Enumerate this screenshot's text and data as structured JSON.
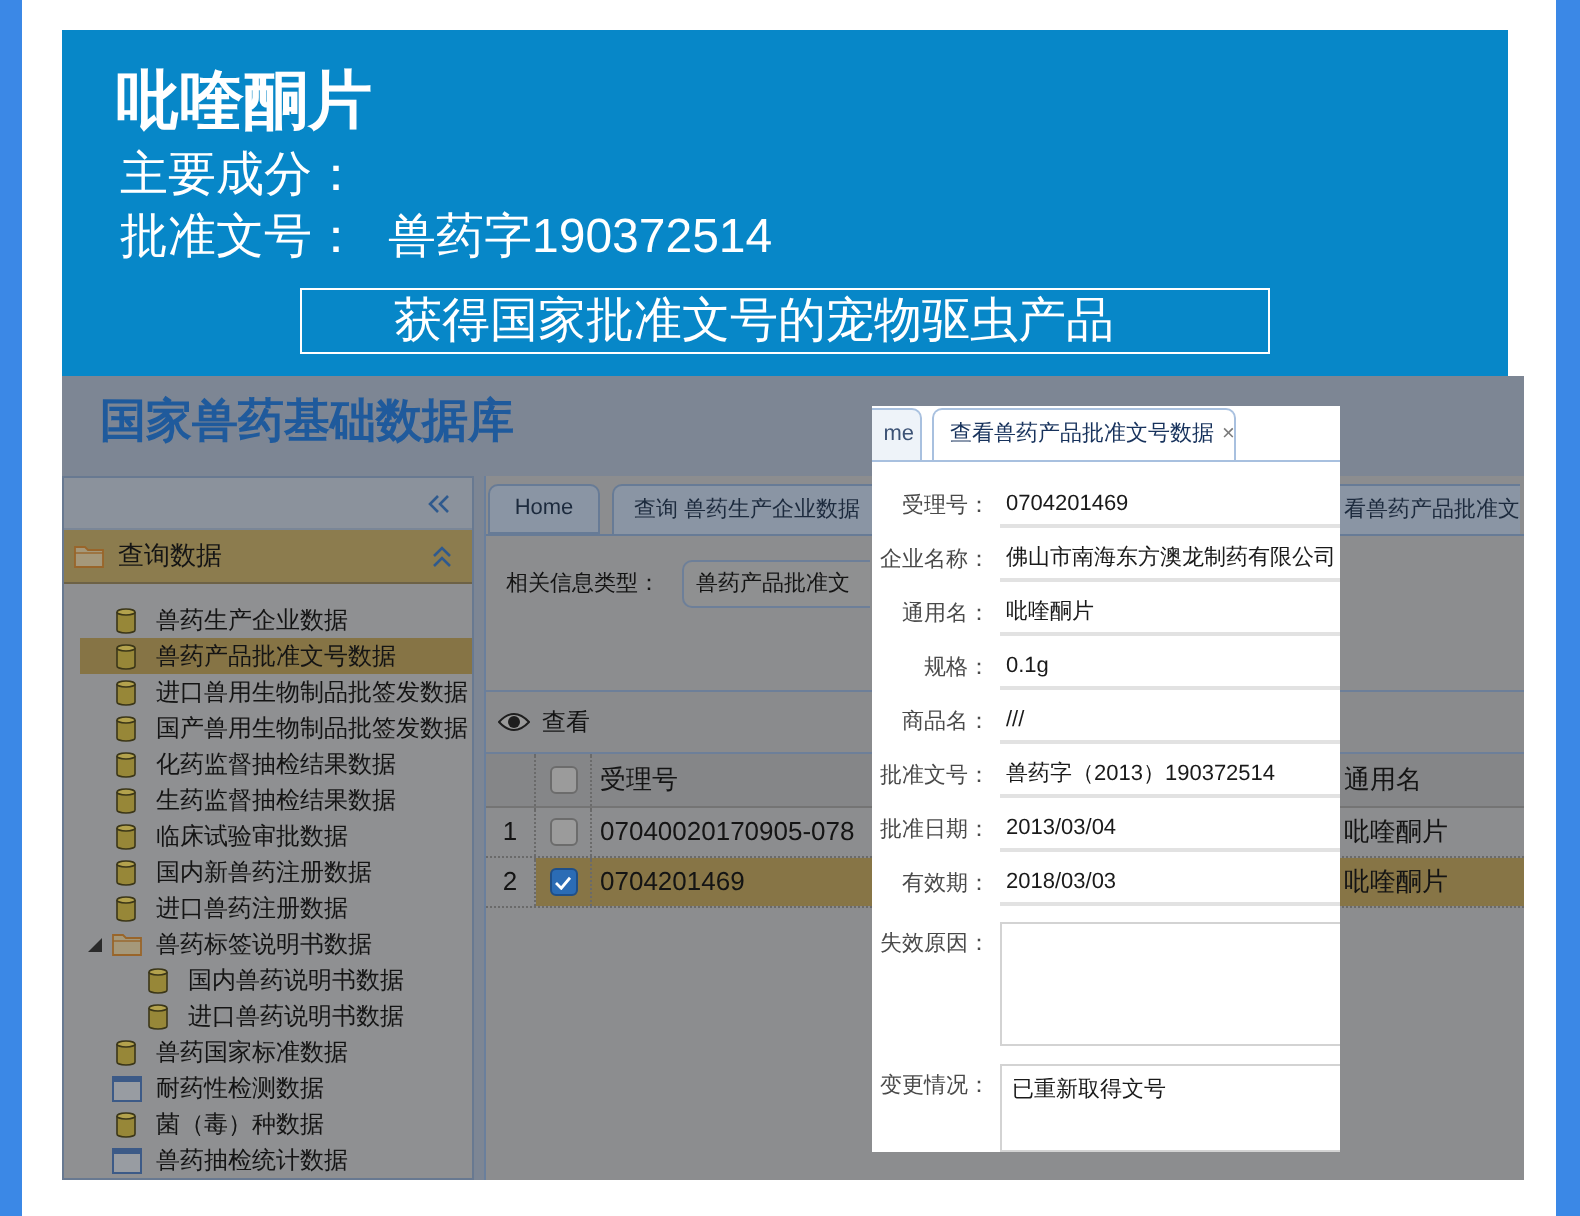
{
  "banner": {
    "title": "吡喹酮片",
    "facts": [
      {
        "label": "主要成分："
      },
      {
        "label": "批准文号：",
        "value": "兽药字190372514"
      }
    ],
    "tagline": "获得国家批准文号的宠物驱虫产品"
  },
  "app": {
    "title": "国家兽药基础数据库",
    "sidebar": {
      "section": {
        "title": "查询数据",
        "expanded": true
      },
      "items": [
        {
          "label": "兽药生产企业数据",
          "kind": "database",
          "selected": false
        },
        {
          "label": "兽药产品批准文号数据",
          "kind": "database",
          "selected": true
        },
        {
          "label": "进口兽用生物制品批签发数据",
          "kind": "database",
          "selected": false
        },
        {
          "label": "国产兽用生物制品批签发数据",
          "kind": "database",
          "selected": false
        },
        {
          "label": "化药监督抽检结果数据",
          "kind": "database",
          "selected": false
        },
        {
          "label": "生药监督抽检结果数据",
          "kind": "database",
          "selected": false
        },
        {
          "label": "临床试验审批数据",
          "kind": "database",
          "selected": false
        },
        {
          "label": "国内新兽药注册数据",
          "kind": "database",
          "selected": false
        },
        {
          "label": "进口兽药注册数据",
          "kind": "database",
          "selected": false
        },
        {
          "label": "兽药标签说明书数据",
          "kind": "folder",
          "selected": false,
          "expanded": true,
          "children": [
            {
              "label": "国内兽药说明书数据",
              "kind": "database",
              "selected": false
            },
            {
              "label": "进口兽药说明书数据",
              "kind": "database",
              "selected": false
            }
          ]
        },
        {
          "label": "兽药国家标准数据",
          "kind": "database",
          "selected": false
        },
        {
          "label": "耐药性检测数据",
          "kind": "table",
          "selected": false
        },
        {
          "label": "菌（毒）种数据",
          "kind": "database",
          "selected": false
        },
        {
          "label": "兽药抽检统计数据",
          "kind": "table",
          "selected": false
        }
      ]
    },
    "tabs": [
      {
        "label": "Home"
      },
      {
        "label": "查询 兽药生产企业数据"
      },
      {
        "label": "看兽药产品批准文"
      }
    ],
    "filter": {
      "label": "相关信息类型：",
      "value": "兽药产品批准文"
    },
    "toolbar": {
      "view_button": "查看"
    },
    "grid": {
      "columns": [
        "受理号",
        "通用名"
      ],
      "select_all_checked": false,
      "rows": [
        {
          "number": "1",
          "checked": false,
          "selected": false,
          "cells": [
            "07040020170905-078",
            "吡喹酮片"
          ]
        },
        {
          "number": "2",
          "checked": true,
          "selected": true,
          "cells": [
            "0704201469",
            "吡喹酮片"
          ]
        }
      ]
    }
  },
  "detail_popup": {
    "tabs": [
      {
        "label": "me",
        "selected": false
      },
      {
        "label": "查看兽药产品批准文号数据",
        "selected": true,
        "close": "×"
      }
    ],
    "fields": [
      {
        "label": "受理号：",
        "value": "0704201469",
        "kind": "line"
      },
      {
        "label": "企业名称：",
        "value": "佛山市南海东方澳龙制药有限公司",
        "kind": "line"
      },
      {
        "label": "通用名：",
        "value": "吡喹酮片",
        "kind": "line"
      },
      {
        "label": "规格：",
        "value": "0.1g",
        "kind": "line"
      },
      {
        "label": "商品名：",
        "value": "///",
        "kind": "line"
      },
      {
        "label": "批准文号：",
        "value": "兽药字（2013）190372514",
        "kind": "line"
      },
      {
        "label": "批准日期：",
        "value": "2013/03/04",
        "kind": "line"
      },
      {
        "label": "有效期：",
        "value": "2018/03/03",
        "kind": "line"
      },
      {
        "label": "失效原因：",
        "kind": "area"
      },
      {
        "label": "变更情况：",
        "value": "已重新取得文号",
        "kind": "area"
      }
    ]
  }
}
